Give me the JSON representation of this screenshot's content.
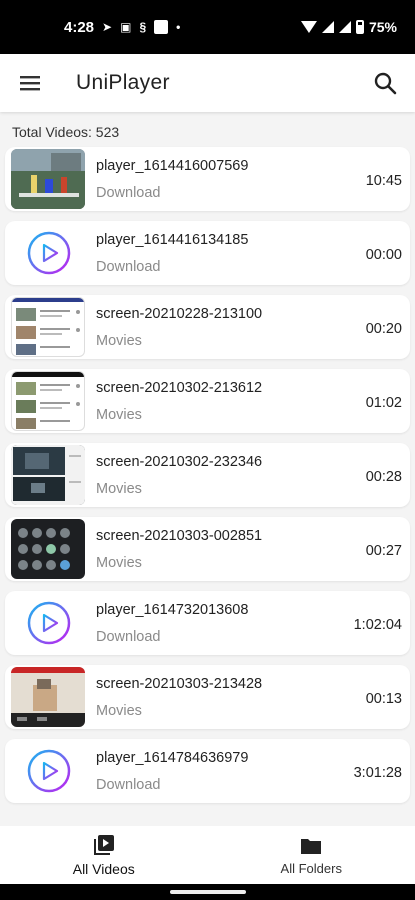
{
  "status_bar": {
    "time": "4:28",
    "battery": "75%"
  },
  "app_bar": {
    "title": "UniPlayer",
    "menu_icon": "menu-icon",
    "search_icon": "search-icon"
  },
  "total_videos": "Total Videos: 523",
  "videos": [
    {
      "title": "player_1614416007569",
      "folder": "Download",
      "duration": "10:45",
      "thumb": "video-frame"
    },
    {
      "title": "player_1614416134185",
      "folder": "Download",
      "duration": "00:00",
      "thumb": "play-icon"
    },
    {
      "title": "screen-20210228-213100",
      "folder": "Movies",
      "duration": "00:20",
      "thumb": "screen-frame"
    },
    {
      "title": "screen-20210302-213612",
      "folder": "Movies",
      "duration": "01:02",
      "thumb": "screen-frame"
    },
    {
      "title": "screen-20210302-232346",
      "folder": "Movies",
      "duration": "00:28",
      "thumb": "screen-frame"
    },
    {
      "title": "screen-20210303-002851",
      "folder": "Movies",
      "duration": "00:27",
      "thumb": "screen-frame"
    },
    {
      "title": "player_1614732013608",
      "folder": "Download",
      "duration": "1:02:04",
      "thumb": "play-icon"
    },
    {
      "title": "screen-20210303-213428",
      "folder": "Movies",
      "duration": "00:13",
      "thumb": "screen-frame"
    },
    {
      "title": "player_1614784636979",
      "folder": "Download",
      "duration": "3:01:28",
      "thumb": "play-icon"
    }
  ],
  "bottom_nav": [
    {
      "label": "All Videos",
      "icon": "video-library-icon",
      "active": true
    },
    {
      "label": "All Folders",
      "icon": "folder-icon",
      "active": false
    }
  ],
  "colors": {
    "accent_gradient_start": "#19b6f0",
    "accent_gradient_end": "#c21ff0"
  }
}
